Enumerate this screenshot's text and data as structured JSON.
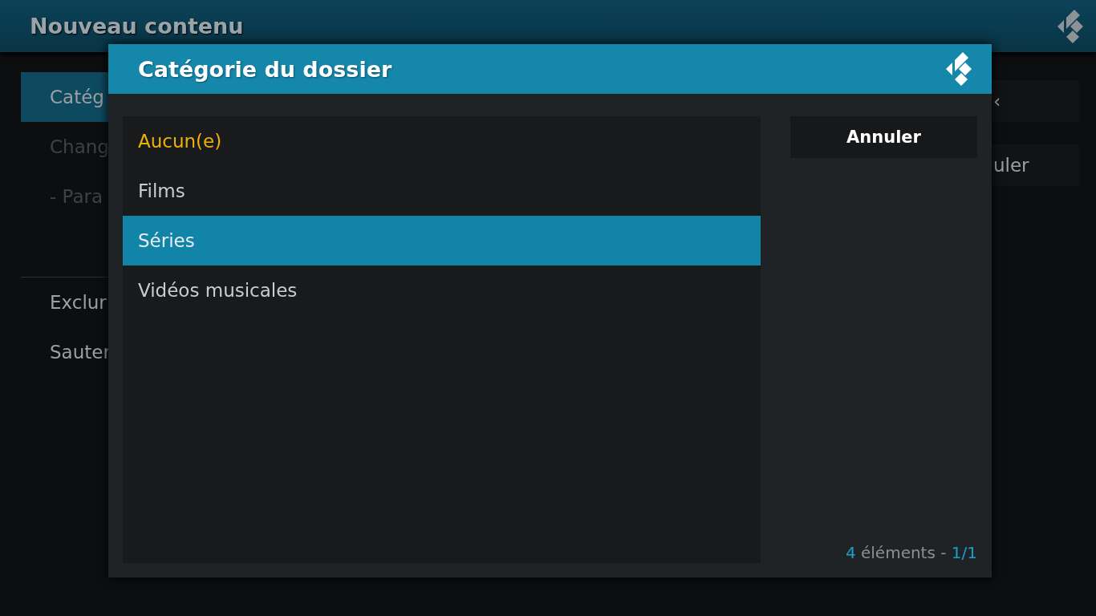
{
  "header": {
    "title": "Nouveau contenu"
  },
  "background_dialog": {
    "items": [
      {
        "label": "Catég",
        "selected": true,
        "disabled": false
      },
      {
        "label": "Chang",
        "selected": false,
        "disabled": true
      },
      {
        "label": "- Para",
        "selected": false,
        "disabled": true
      }
    ],
    "more_items": [
      {
        "label": "Exclur",
        "selected": false,
        "disabled": false
      },
      {
        "label": "Sauter",
        "selected": false,
        "disabled": false
      }
    ],
    "buttons": [
      {
        "label": "‹"
      },
      {
        "label": "uler"
      }
    ]
  },
  "dialog": {
    "title": "Catégorie du dossier",
    "items": [
      {
        "label": "Aucun(e)",
        "selected": false,
        "current": true
      },
      {
        "label": "Films",
        "selected": false,
        "current": false
      },
      {
        "label": "Séries",
        "selected": true,
        "current": false
      },
      {
        "label": "Vidéos musicales",
        "selected": false,
        "current": false
      }
    ],
    "buttons": [
      "Annuler"
    ],
    "footer": {
      "count": "4",
      "label": "éléments -",
      "page": "1/1"
    }
  }
}
